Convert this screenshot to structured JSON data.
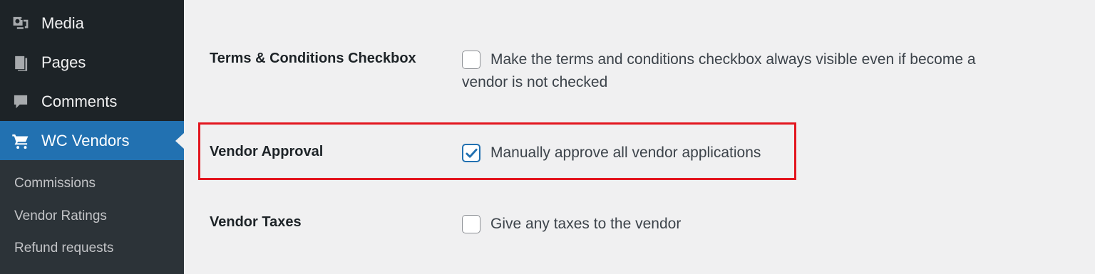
{
  "sidebar": {
    "menu": [
      {
        "label": "Media",
        "icon": "media-icon"
      },
      {
        "label": "Pages",
        "icon": "pages-icon"
      },
      {
        "label": "Comments",
        "icon": "comments-icon"
      },
      {
        "label": "WC Vendors",
        "icon": "cart-icon",
        "active": true
      }
    ],
    "submenu": [
      {
        "label": "Commissions"
      },
      {
        "label": "Vendor Ratings"
      },
      {
        "label": "Refund requests"
      }
    ]
  },
  "settings": {
    "terms": {
      "label": "Terms & Conditions Checkbox",
      "option_line1": "Make the terms and conditions checkbox always visible even if become a",
      "option_line2": "vendor is not checked",
      "checked": false
    },
    "approval": {
      "label": "Vendor Approval",
      "option": "Manually approve all vendor applications",
      "checked": true
    },
    "taxes": {
      "label": "Vendor Taxes",
      "option": "Give any taxes to the vendor",
      "checked": false
    }
  },
  "colors": {
    "sidebar_bg": "#1d2327",
    "submenu_bg": "#2c3338",
    "active_bg": "#2271b1",
    "highlight_border": "#e3161f",
    "page_bg": "#f0f0f1"
  }
}
